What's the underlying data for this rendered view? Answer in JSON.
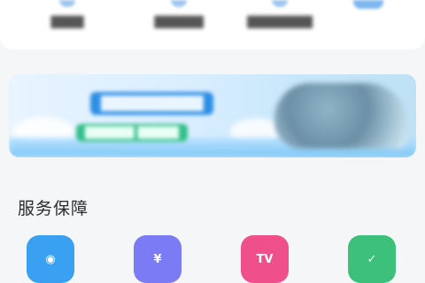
{
  "top_nav": {
    "items": [
      {
        "label": "████",
        "active": false
      },
      {
        "label": "██████",
        "active": false
      },
      {
        "label": "████████",
        "active": false
      },
      {
        "label": "",
        "active": true
      }
    ]
  },
  "banner": {
    "title": "██████████",
    "subtitle": "██████ █████"
  },
  "services": {
    "title": "服务保障",
    "items": [
      {
        "icon": "eye-icon",
        "glyph": "◉",
        "color": "#3aa0f2"
      },
      {
        "icon": "yuan-coin-icon",
        "glyph": "¥",
        "color": "#7b7bf5"
      },
      {
        "icon": "tv-icon",
        "glyph": "TV",
        "color": "#f0508a"
      },
      {
        "icon": "shield-check-icon",
        "glyph": "✓",
        "color": "#3cc07a"
      }
    ]
  }
}
